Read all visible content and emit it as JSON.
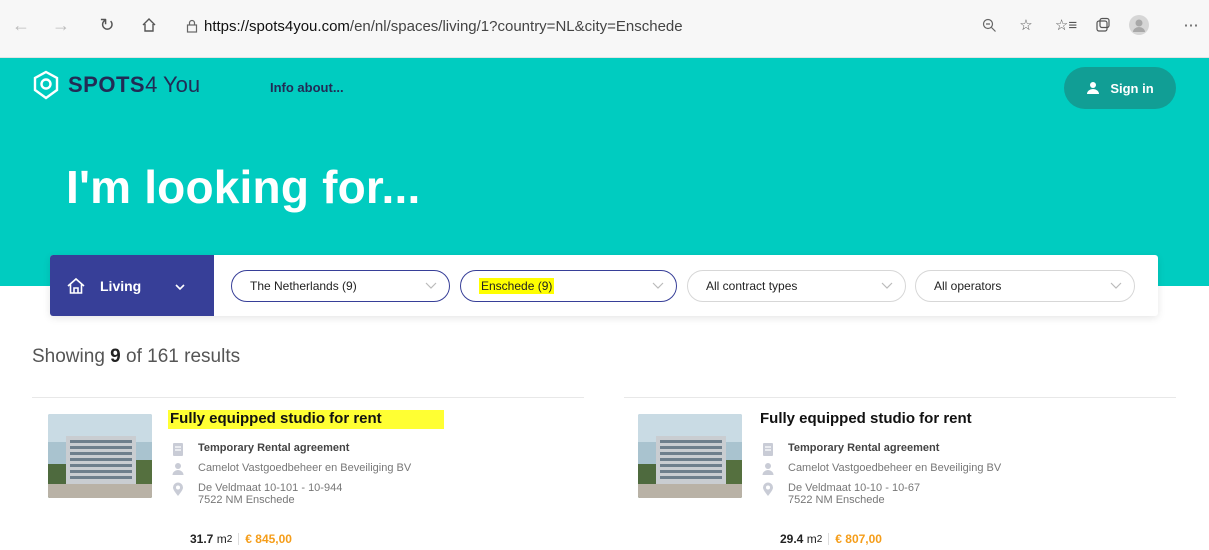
{
  "browser": {
    "url_host": "https://spots4you.com",
    "url_path": "/en/nl/spaces/living/1?country=NL&city=Enschede"
  },
  "header": {
    "logo_bold": "SPOTS",
    "logo_light": "4 You",
    "info_link": "Info about...",
    "sign_in": "Sign in"
  },
  "hero": {
    "title": "I'm looking for..."
  },
  "filters": {
    "category": "Living",
    "country": "The Netherlands (9)",
    "city": "Enschede (9)",
    "contract": "All contract types",
    "operator": "All operators"
  },
  "results": {
    "prefix": "Showing",
    "shown": "9",
    "middle": "of 161 results"
  },
  "listings": [
    {
      "title": "Fully equipped studio for rent",
      "agreement": "Temporary Rental agreement",
      "operator": "Camelot Vastgoedbeheer en Beveiliging BV",
      "address1": "De Veldmaat 10-101 - 10-944",
      "address2": "7522 NM Enschede",
      "area": "31.7",
      "price": "€ 845,00"
    },
    {
      "title": "Fully equipped studio for rent",
      "agreement": "Temporary Rental agreement",
      "operator": "Camelot Vastgoedbeheer en Beveiliging BV",
      "address1": "De Veldmaat 10-10 - 10-67",
      "address2": "7522 NM Enschede",
      "area": "29.4",
      "price": "€ 807,00"
    }
  ],
  "units": {
    "area_unit": "m",
    "area_exp": "2"
  },
  "colors": {
    "teal": "#00ccc0",
    "navy": "#373f98",
    "sign_in": "#119e95",
    "price": "#f59d19",
    "highlight": "#ffff00"
  }
}
